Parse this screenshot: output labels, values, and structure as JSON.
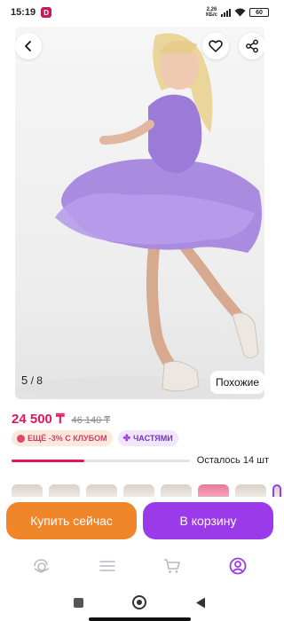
{
  "status": {
    "time": "15:19",
    "app_badge": "D",
    "speed_top": "2.26",
    "speed_bottom": "КБ/с",
    "battery": "60"
  },
  "gallery": {
    "current": "5",
    "total": "/ 8",
    "similar_label": "Похожие"
  },
  "price": {
    "current": "24 500 ₸",
    "old": "46 140 ₸"
  },
  "badges": {
    "club": "ЕЩЁ -3% С КЛУБОМ",
    "parts": "ЧАСТЯМИ"
  },
  "stock": {
    "text": "Осталось 14 шт",
    "fill_fraction": 0.41
  },
  "actions": {
    "buy_now": "Купить сейчас",
    "add_to_cart": "В корзину"
  },
  "colors": {
    "price": "#e0165c",
    "buy_now": "#f0862a",
    "cart": "#9b3ae8",
    "club_badge_text": "#d23c6a",
    "parts_badge_text": "#7a2fc4"
  },
  "icons": [
    "back-arrow-icon",
    "heart-icon",
    "share-icon",
    "catalog-icon",
    "menu-icon",
    "cart-icon",
    "profile-icon"
  ]
}
